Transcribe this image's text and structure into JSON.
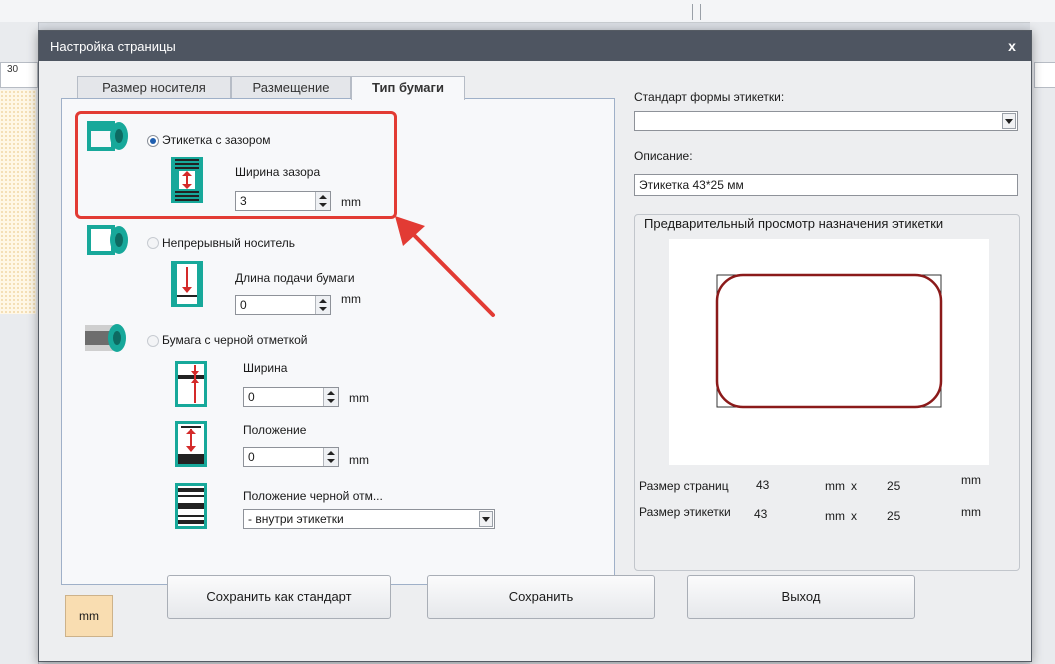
{
  "window": {
    "title": "Настройка страницы",
    "close_label": "x"
  },
  "background": {
    "ruler_value": "30"
  },
  "tabs": [
    {
      "label": "Размер носителя",
      "active": false
    },
    {
      "label": "Размещение",
      "active": false
    },
    {
      "label": "Тип бумаги",
      "active": true
    }
  ],
  "paper_type": {
    "gap_label": {
      "label": "Этикетка с зазором",
      "selected": true,
      "gap_width_label": "Ширина зазора",
      "gap_width_value": "3",
      "unit": "mm"
    },
    "continuous": {
      "label": "Непрерывный носитель",
      "selected": false,
      "feed_length_label": "Длина подачи бумаги",
      "feed_length_value": "0",
      "unit": "mm"
    },
    "black_mark": {
      "label": "Бумага с черной отметкой",
      "selected": false,
      "width_label": "Ширина",
      "width_value": "0",
      "position_label": "Положение",
      "position_value": "0",
      "mark_position_label": "Положение черной отм...",
      "mark_position_value": "- внутри этикетки",
      "unit": "mm"
    }
  },
  "right_panel": {
    "standard_label": "Стандарт формы этикетки:",
    "standard_value": "",
    "description_label": "Описание:",
    "description_value": "Этикетка 43*25 мм",
    "preview_title": "Предварительный просмотр назначения этикетки",
    "page_size_label": "Размер страниц",
    "page_size_w": "43",
    "page_size_h": "25",
    "label_size_label": "Размер этикетки",
    "label_size_w": "43",
    "label_size_h": "25",
    "unit": "mm",
    "times": "x"
  },
  "footer": {
    "unit_box": "mm",
    "save_as_standard": "Сохранить как стандарт",
    "save": "Сохранить",
    "exit": "Выход"
  },
  "colors": {
    "titlebar": "#4e5561",
    "highlight": "#e23b34",
    "label_border": "#8b1a1a",
    "icon_teal": "#17a89a"
  }
}
